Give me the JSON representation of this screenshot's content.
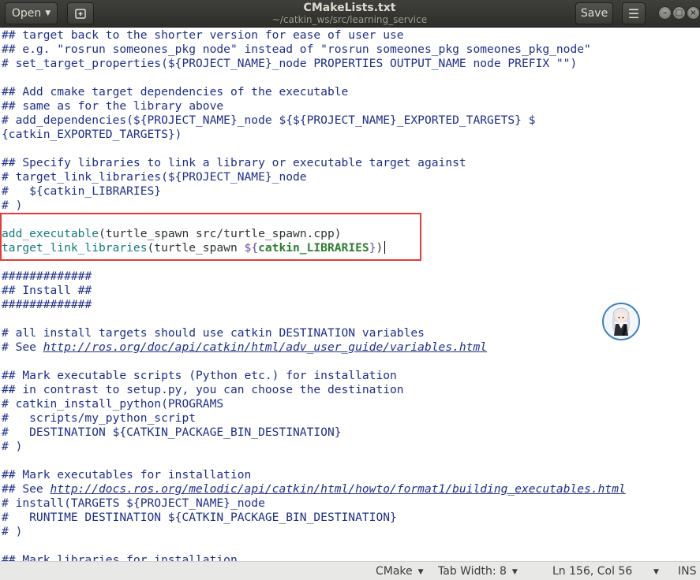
{
  "header": {
    "open_label": "Open",
    "title": "CMakeLists.txt",
    "subtitle": "~/catkin_ws/src/learning_service",
    "save_label": "Save"
  },
  "editor": {
    "lines": [
      "## target back to the shorter version for ease of user use",
      "## e.g. \"rosrun someones_pkg node\" instead of \"rosrun someones_pkg someones_pkg_node\"",
      "# set_target_properties(${PROJECT_NAME}_node PROPERTIES OUTPUT_NAME node PREFIX \"\")",
      "",
      "## Add cmake target dependencies of the executable",
      "## same as for the library above",
      "# add_dependencies(${PROJECT_NAME}_node ${${PROJECT_NAME}_EXPORTED_TARGETS} $",
      "{catkin_EXPORTED_TARGETS})",
      "",
      "## Specify libraries to link a library or executable target against",
      "# target_link_libraries(${PROJECT_NAME}_node",
      "#   ${catkin_LIBRARIES}",
      "# )",
      "",
      "add_executable(turtle_spawn src/turtle_spawn.cpp)",
      "target_link_libraries(turtle_spawn ${catkin_LIBRARIES})",
      "",
      "#############",
      "## Install ##",
      "#############",
      "",
      "# all install targets should use catkin DESTINATION variables",
      "# See http://ros.org/doc/api/catkin/html/adv_user_guide/variables.html",
      "",
      "## Mark executable scripts (Python etc.) for installation",
      "## in contrast to setup.py, you can choose the destination",
      "# catkin_install_python(PROGRAMS",
      "#   scripts/my_python_script",
      "#   DESTINATION ${CATKIN_PACKAGE_BIN_DESTINATION}",
      "# )",
      "",
      "## Mark executables for installation",
      "## See http://docs.ros.org/melodic/api/catkin/html/howto/format1/building_executables.html",
      "# install(TARGETS ${PROJECT_NAME}_node",
      "#   RUNTIME DESTINATION ${CATKIN_PACKAGE_BIN_DESTINATION}",
      "# )",
      "",
      "## Mark libraries for installation"
    ],
    "code_parts": {
      "add_executable_kw": "add_executable",
      "add_executable_args": "(turtle_spawn src/turtle_spawn.cpp)",
      "tll_kw": "target_link_libraries",
      "tll_args": "(turtle_spawn ",
      "tll_var_open": "${",
      "tll_var_name": "catkin_LIBRARIES",
      "tll_var_close": "}",
      "tll_end": ")"
    },
    "url_lines": {
      "see1_prefix": "# See ",
      "see1_url": "http://ros.org/doc/api/catkin/html/adv_user_guide/variables.html",
      "see2_prefix": "## See ",
      "see2_url": "http://docs.ros.org/melodic/api/catkin/html/howto/format1/building_executables.html"
    }
  },
  "statusbar": {
    "language": "CMake",
    "tab_width": "Tab Width: 8",
    "position": "Ln 156, Col 56",
    "mode": "INS"
  },
  "colors": {
    "comment": "#1e2f8c",
    "keyword": "#127b7d",
    "variable": "#2e7d32",
    "highlight_box": "#e5393a"
  }
}
